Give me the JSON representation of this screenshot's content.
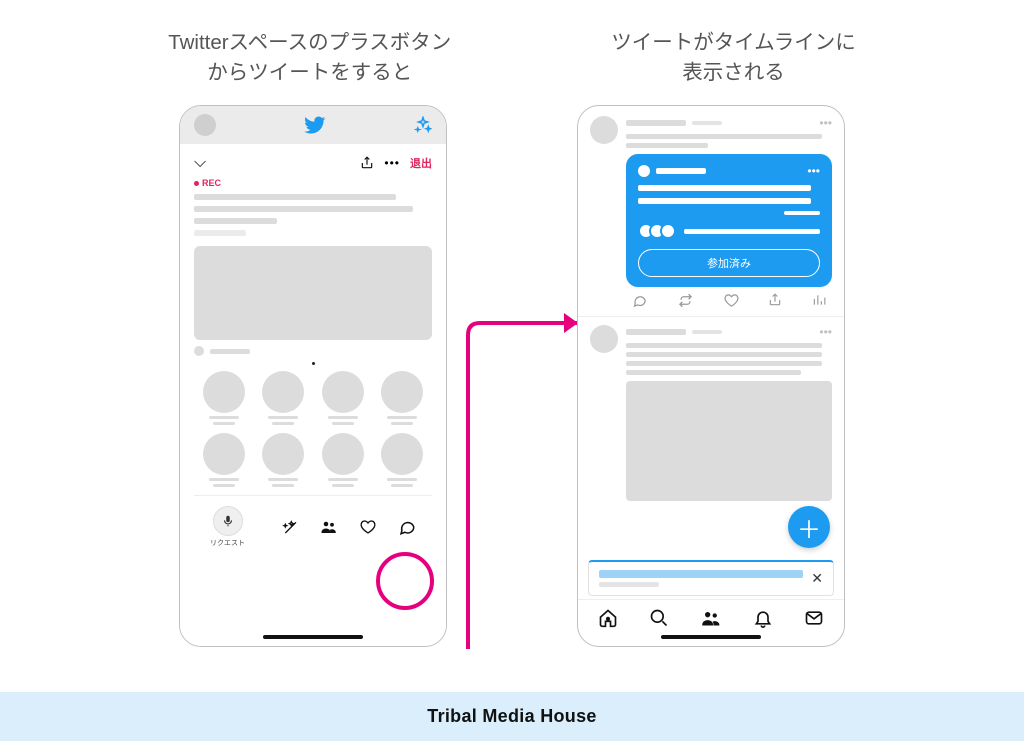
{
  "captions": {
    "left": "Twitterスペースのプラスボタン\nからツイートをすると",
    "right": "ツイートがタイムラインに\n表示される"
  },
  "left_phone": {
    "rec_label": "REC",
    "leave_label": "退出",
    "request_label": "リクエスト"
  },
  "right_phone": {
    "joined_label": "参加済み"
  },
  "footer": "Tribal Media House",
  "colors": {
    "twitter_blue": "#1d9bf0",
    "magenta": "#e6007e",
    "footer_bg": "#daeefb"
  }
}
